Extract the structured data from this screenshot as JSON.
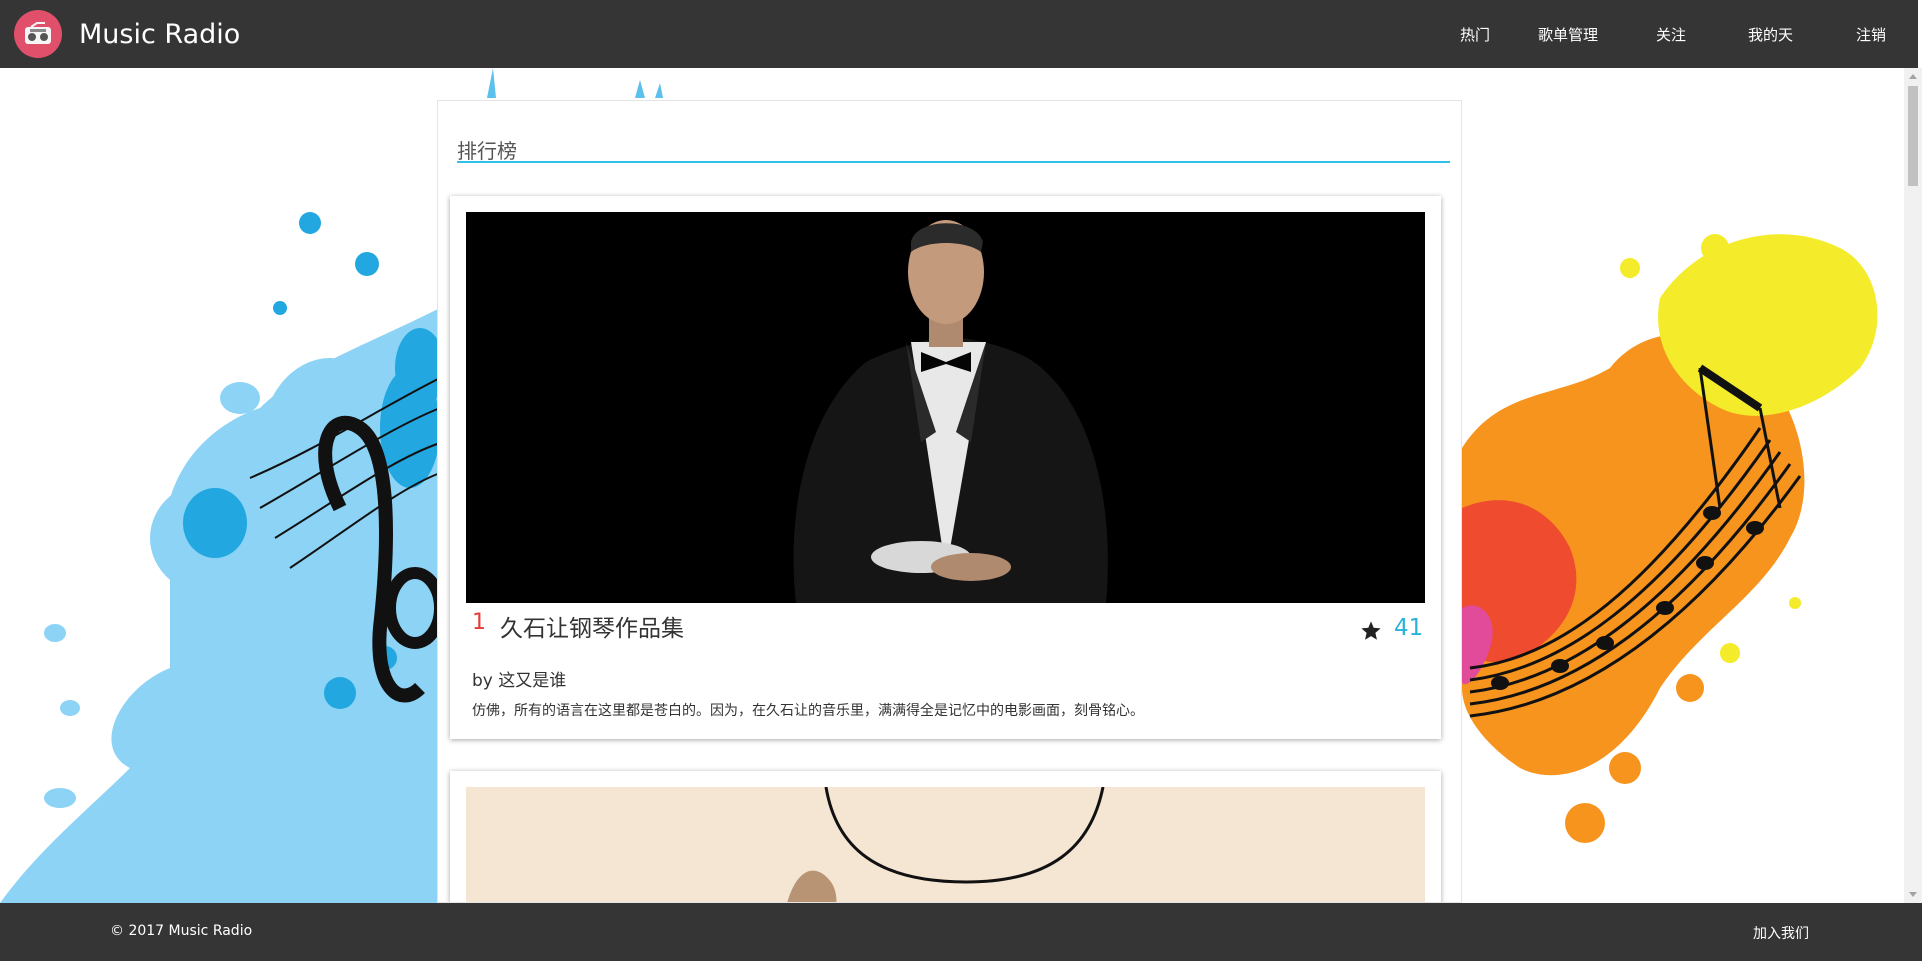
{
  "header": {
    "brand": "Music Radio",
    "nav": [
      "热门",
      "歌单管理",
      "关注",
      "我的天",
      "注销"
    ]
  },
  "ranking": {
    "title": "排行榜",
    "items": [
      {
        "rank": "1",
        "title": "久石让钢琴作品集",
        "stars": "41",
        "byline": "by 这又是谁",
        "description": "仿佛，所有的语言在这里都是苍白的。因为，在久石让的音乐里，满满得全是记忆中的电影画面，刻骨铭心。"
      }
    ]
  },
  "footer": {
    "copyright": "© 2017 Music Radio",
    "join": "加入我们"
  },
  "colors": {
    "navbar": "#353535",
    "accent": "#2ec0e8",
    "rank": "#e43c3c",
    "logo": "#e0506a"
  }
}
